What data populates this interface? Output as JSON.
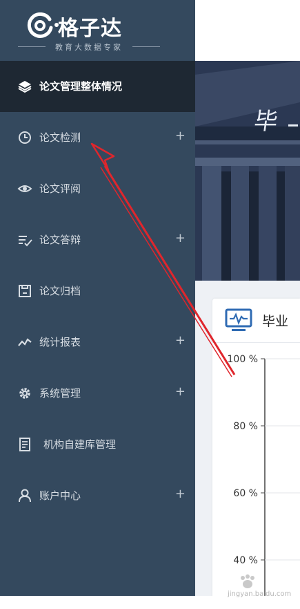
{
  "logo": {
    "name": "格子达",
    "subtitle": "教育大数据专家"
  },
  "sidebar": {
    "items": [
      {
        "label": "论文管理整体情况",
        "icon": "layers-icon",
        "plus": ""
      },
      {
        "label": "论文检测",
        "icon": "clock-icon",
        "plus": "+"
      },
      {
        "label": "论文评阅",
        "icon": "eye-icon",
        "plus": ""
      },
      {
        "label": "论文答辩",
        "icon": "list-check-icon",
        "plus": "+"
      },
      {
        "label": "论文归档",
        "icon": "archive-icon",
        "plus": ""
      },
      {
        "label": "统计报表",
        "icon": "trend-icon",
        "plus": "+"
      },
      {
        "label": "系统管理",
        "icon": "gear-icon",
        "plus": "+"
      },
      {
        "label": "机构自建库管理",
        "icon": "document-icon",
        "plus": ""
      },
      {
        "label": "账户中心",
        "icon": "user-icon",
        "plus": "+"
      }
    ]
  },
  "banner": {
    "calligraphy": "毕"
  },
  "panel": {
    "title": "毕业"
  },
  "chart_data": {
    "type": "line",
    "title": "毕业",
    "yticks": [
      "100 %",
      "80 %",
      "60 %",
      "40 %"
    ],
    "ylim": [
      40,
      100
    ]
  },
  "watermark": {
    "text": "jingyan.baidu.com"
  },
  "colors": {
    "sidebar": "#34495e",
    "active": "#1e2833",
    "accent": "#2f6bb3",
    "arrow": "#e0262c"
  }
}
